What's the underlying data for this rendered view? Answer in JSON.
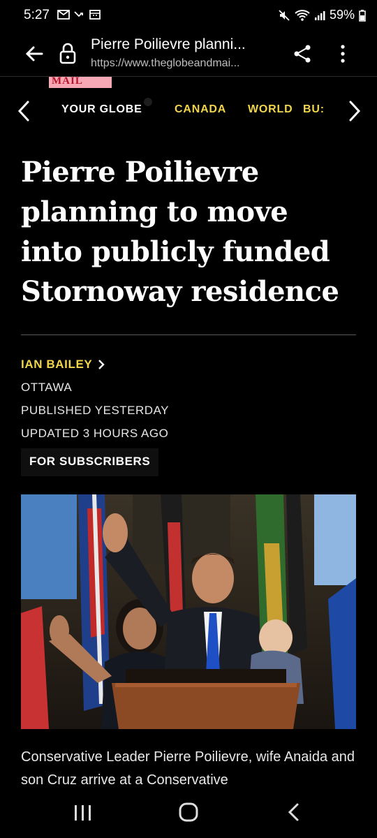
{
  "status_bar": {
    "time": "5:27",
    "battery": "59%"
  },
  "browser": {
    "tab_title": "Pierre Poilievre planni...",
    "url": "https://www.theglobeandmai..."
  },
  "logo_fragment": "MAIL",
  "section_nav": {
    "items": [
      "YOUR GLOBE",
      "CANADA",
      "WORLD",
      "BU:"
    ]
  },
  "article": {
    "headline": "Pierre Poilievre planning to move into publicly funded Stornoway residence",
    "author": "IAN BAILEY",
    "location": "OTTAWA",
    "published": "PUBLISHED YESTERDAY",
    "updated": "UPDATED 3 HOURS AGO",
    "access_badge": "FOR SUBSCRIBERS",
    "caption": "Conservative Leader Pierre Poilievre, wife Anaida and son Cruz arrive at a Conservative"
  },
  "colors": {
    "accent_yellow": "#f1d54a",
    "background": "#000000",
    "logo_pink": "#f6a8b4"
  }
}
